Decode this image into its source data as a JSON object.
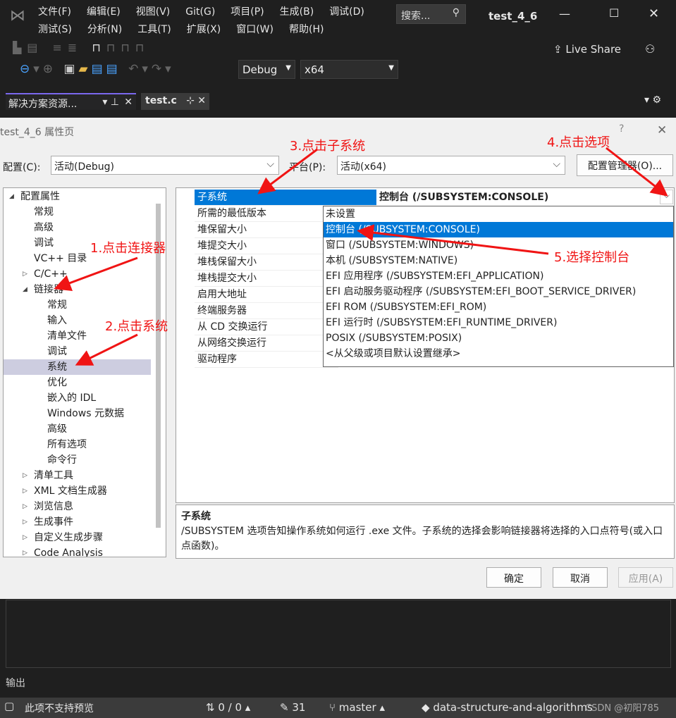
{
  "ide": {
    "menu_row1": [
      "文件(F)",
      "编辑(E)",
      "视图(V)",
      "Git(G)",
      "项目(P)",
      "生成(B)",
      "调试(D)"
    ],
    "menu_row2": [
      "测试(S)",
      "分析(N)",
      "工具(T)",
      "扩展(X)",
      "窗口(W)",
      "帮助(H)"
    ],
    "search_placeholder": "搜索...",
    "window_title": "test_4_6",
    "live_share": "Live Share",
    "config": "Debug",
    "platform": "x64",
    "solution_tab": "解决方案资源...",
    "file_tab": "test.c",
    "output_label": "输出"
  },
  "dialog": {
    "title": "test_4_6 属性页",
    "help": "?",
    "config_label": "配置(C):",
    "config_value": "活动(Debug)",
    "platform_label": "平台(P):",
    "platform_value": "活动(x64)",
    "config_manager": "配置管理器(O)...",
    "tree": [
      {
        "label": "配置属性",
        "level": 0,
        "expander": "◢"
      },
      {
        "label": "常规",
        "level": 1
      },
      {
        "label": "高级",
        "level": 1
      },
      {
        "label": "调试",
        "level": 1
      },
      {
        "label": "VC++ 目录",
        "level": 1
      },
      {
        "label": "C/C++",
        "level": 1,
        "expander": "▷"
      },
      {
        "label": "链接器",
        "level": 1,
        "expander": "◢"
      },
      {
        "label": "常规",
        "level": 2
      },
      {
        "label": "输入",
        "level": 2
      },
      {
        "label": "清单文件",
        "level": 2
      },
      {
        "label": "调试",
        "level": 2
      },
      {
        "label": "系统",
        "level": 2,
        "selected": true
      },
      {
        "label": "优化",
        "level": 2
      },
      {
        "label": "嵌入的 IDL",
        "level": 2
      },
      {
        "label": "Windows 元数据",
        "level": 2
      },
      {
        "label": "高级",
        "level": 2
      },
      {
        "label": "所有选项",
        "level": 2
      },
      {
        "label": "命令行",
        "level": 2
      },
      {
        "label": "清单工具",
        "level": 1,
        "expander": "▷"
      },
      {
        "label": "XML 文档生成器",
        "level": 1,
        "expander": "▷"
      },
      {
        "label": "浏览信息",
        "level": 1,
        "expander": "▷"
      },
      {
        "label": "生成事件",
        "level": 1,
        "expander": "▷"
      },
      {
        "label": "自定义生成步骤",
        "level": 1,
        "expander": "▷"
      },
      {
        "label": "Code Analysis",
        "level": 1,
        "expander": "▷"
      }
    ],
    "properties": [
      "子系统",
      "所需的最低版本",
      "堆保留大小",
      "堆提交大小",
      "堆栈保留大小",
      "堆栈提交大小",
      "启用大地址",
      "终端服务器",
      "从 CD 交换运行",
      "从网络交换运行",
      "驱动程序"
    ],
    "subsystem_value": "控制台 (/SUBSYSTEM:CONSOLE)",
    "options": [
      "未设置",
      "控制台 (/SUBSYSTEM:CONSOLE)",
      "窗口 (/SUBSYSTEM:WINDOWS)",
      "本机 (/SUBSYSTEM:NATIVE)",
      "EFI 应用程序 (/SUBSYSTEM:EFI_APPLICATION)",
      "EFI 启动服务驱动程序 (/SUBSYSTEM:EFI_BOOT_SERVICE_DRIVER)",
      "EFI ROM (/SUBSYSTEM:EFI_ROM)",
      "EFI 运行时 (/SUBSYSTEM:EFI_RUNTIME_DRIVER)",
      "POSIX (/SUBSYSTEM:POSIX)",
      "<从父级或项目默认设置继承>"
    ],
    "selected_option": 1,
    "desc_title": "子系统",
    "desc_text": "/SUBSYSTEM 选项告知操作系统如何运行 .exe 文件。子系统的选择会影响链接器将选择的入口点符号(或入口点函数)。",
    "ok": "确定",
    "cancel": "取消",
    "apply": "应用(A)"
  },
  "annotations": [
    "1.点击连接器",
    "2.点击系统",
    "3.点击子系统",
    "4.点击选项",
    "5.选择控制台"
  ],
  "status": {
    "preview": "此项不支持预览",
    "sync": "0 / 0",
    "edits": "31",
    "branch": "master",
    "repo": "data-structure-and-algorithms",
    "watermark": "CSDN @初阳785"
  },
  "colors": {
    "accent": "#0078d7",
    "annotation": "#f01414"
  }
}
